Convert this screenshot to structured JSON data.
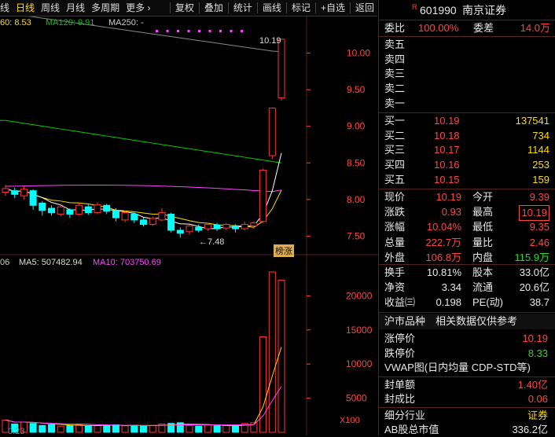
{
  "toolbar": {
    "left_cut": "线",
    "items": [
      "日线",
      "周线",
      "月线",
      "多周期",
      "更多",
      "复权",
      "叠加",
      "统计",
      "画线",
      "标记",
      "+自选",
      "返回"
    ],
    "more_arrow": "›"
  },
  "ma_legend": {
    "ma60_cut": "60: 8.53",
    "ma120": "MA120: 9.91",
    "ma250": "MA250: -"
  },
  "vol_legend": {
    "cut": "06",
    "ma5": "MA5: 507482.94",
    "ma10": "MA10: 703750.69"
  },
  "price_axis": [
    "10.00",
    "9.50",
    "9.00",
    "8.50",
    "8.00",
    "7.50"
  ],
  "vol_axis": [
    "20000",
    "15000",
    "10000",
    "5000"
  ],
  "vol_unit": "X100",
  "annotations": {
    "high": "10.19",
    "low": "7.48",
    "badge": "榜涨",
    "bottom_cut": "0.23"
  },
  "colors": {
    "up": "#ff3232",
    "down": "#00ffff",
    "ma5": "#ffffff",
    "ma10": "#ffdd00",
    "ma20": "#ff44ff",
    "ma60": "#00cc00",
    "ma250": "#888888"
  },
  "quote": {
    "flag": "R",
    "code": "601990",
    "name": "南京证券",
    "weibi_label": "委比",
    "weibi": "100.00%",
    "weicha_label": "委差",
    "weicha": "14.0万",
    "sells": [
      "卖五",
      "卖四",
      "卖三",
      "卖二",
      "卖一"
    ],
    "buys": [
      {
        "label": "买一",
        "price": "10.19",
        "vol": "137541"
      },
      {
        "label": "买二",
        "price": "10.18",
        "vol": "734"
      },
      {
        "label": "买三",
        "price": "10.17",
        "vol": "1144"
      },
      {
        "label": "买四",
        "price": "10.16",
        "vol": "253"
      },
      {
        "label": "买五",
        "price": "10.15",
        "vol": "159"
      }
    ],
    "stats": [
      {
        "l1": "现价",
        "v1": "10.19",
        "l2": "今开",
        "v2": "9.39"
      },
      {
        "l1": "涨跌",
        "v1": "0.93",
        "l2": "最高",
        "v2": "10.19"
      },
      {
        "l1": "涨幅",
        "v1": "10.04%",
        "l2": "最低",
        "v2": "9.35"
      },
      {
        "l1": "总量",
        "v1": "222.7万",
        "l2": "量比",
        "v2": "2.46"
      },
      {
        "l1": "外盘",
        "v1": "106.8万",
        "l2": "内盘",
        "v2": "115.9万"
      }
    ],
    "stats2": [
      {
        "l1": "换手",
        "v1": "10.81%",
        "l2": "股本",
        "v2": "33.0亿"
      },
      {
        "l1": "净资",
        "v1": "3.34",
        "l2": "流通",
        "v2": "20.6亿"
      },
      {
        "l1": "收益㈢",
        "v1": "0.198",
        "l2": "PE(动)",
        "v2": "38.7"
      }
    ],
    "section_title": "沪市品种",
    "section_note": "相关数据仅供参考",
    "limit_up_label": "涨停价",
    "limit_up": "10.19",
    "limit_down_label": "跌停价",
    "limit_down": "8.33",
    "vwap": "VWAP图(日内均量 CDP-STD等)",
    "seal_amt_label": "封单额",
    "seal_amt": "1.40亿",
    "seal_ratio_label": "封成比",
    "seal_ratio": "0.06",
    "industry_label": "细分行业",
    "industry": "证券",
    "ab_label": "AB股总市值",
    "ab": "336.2亿"
  },
  "chart_data": {
    "type": "candlestick",
    "ylim": [
      7.3,
      10.35
    ],
    "candles": [
      {
        "o": 8.1,
        "c": 8.15,
        "h": 8.2,
        "l": 8.05
      },
      {
        "o": 8.12,
        "c": 8.07,
        "h": 8.16,
        "l": 8.02
      },
      {
        "o": 8.05,
        "c": 8.14,
        "h": 8.18,
        "l": 8.0
      },
      {
        "o": 8.12,
        "c": 7.92,
        "h": 8.14,
        "l": 7.86
      },
      {
        "o": 7.95,
        "c": 7.85,
        "h": 7.98,
        "l": 7.78
      },
      {
        "o": 7.88,
        "c": 7.82,
        "h": 7.92,
        "l": 7.78
      },
      {
        "o": 7.8,
        "c": 7.9,
        "h": 7.94,
        "l": 7.77
      },
      {
        "o": 7.86,
        "c": 7.8,
        "h": 7.88,
        "l": 7.75
      },
      {
        "o": 7.8,
        "c": 7.92,
        "h": 7.95,
        "l": 7.78
      },
      {
        "o": 7.9,
        "c": 7.82,
        "h": 7.93,
        "l": 7.79
      },
      {
        "o": 7.82,
        "c": 7.93,
        "h": 7.96,
        "l": 7.8
      },
      {
        "o": 7.92,
        "c": 7.84,
        "h": 7.94,
        "l": 7.8
      },
      {
        "o": 7.85,
        "c": 7.75,
        "h": 7.88,
        "l": 7.7
      },
      {
        "o": 7.72,
        "c": 7.82,
        "h": 7.85,
        "l": 7.69
      },
      {
        "o": 7.8,
        "c": 7.72,
        "h": 7.82,
        "l": 7.68
      },
      {
        "o": 7.72,
        "c": 7.66,
        "h": 7.75,
        "l": 7.63
      },
      {
        "o": 7.66,
        "c": 7.74,
        "h": 7.77,
        "l": 7.64
      },
      {
        "o": 7.72,
        "c": 7.82,
        "h": 7.88,
        "l": 7.7
      },
      {
        "o": 7.8,
        "c": 7.58,
        "h": 7.82,
        "l": 7.55
      },
      {
        "o": 7.58,
        "c": 7.54,
        "h": 7.62,
        "l": 7.48
      },
      {
        "o": 7.56,
        "c": 7.64,
        "h": 7.66,
        "l": 7.52
      },
      {
        "o": 7.62,
        "c": 7.58,
        "h": 7.66,
        "l": 7.55
      },
      {
        "o": 7.6,
        "c": 7.66,
        "h": 7.68,
        "l": 7.57
      },
      {
        "o": 7.65,
        "c": 7.6,
        "h": 7.68,
        "l": 7.57
      },
      {
        "o": 7.61,
        "c": 7.66,
        "h": 7.68,
        "l": 7.58
      },
      {
        "o": 7.64,
        "c": 7.6,
        "h": 7.66,
        "l": 7.55
      },
      {
        "o": 7.6,
        "c": 7.66,
        "h": 7.7,
        "l": 7.58
      },
      {
        "o": 7.64,
        "c": 7.68,
        "h": 7.7,
        "l": 7.6
      },
      {
        "o": 7.7,
        "c": 8.4,
        "h": 8.42,
        "l": 7.68
      },
      {
        "o": 8.6,
        "c": 9.25,
        "h": 9.25,
        "l": 8.55
      },
      {
        "o": 9.39,
        "c": 10.19,
        "h": 10.19,
        "l": 9.35
      }
    ],
    "volumes": [
      1800,
      1200,
      1500,
      1300,
      1000,
      1100,
      900,
      1000,
      1100,
      900,
      1000,
      1050,
      1100,
      950,
      1000,
      900,
      1000,
      1200,
      1300,
      1400,
      1000,
      900,
      1100,
      950,
      1000,
      900,
      1300,
      1400,
      14000,
      23500,
      22300
    ]
  }
}
